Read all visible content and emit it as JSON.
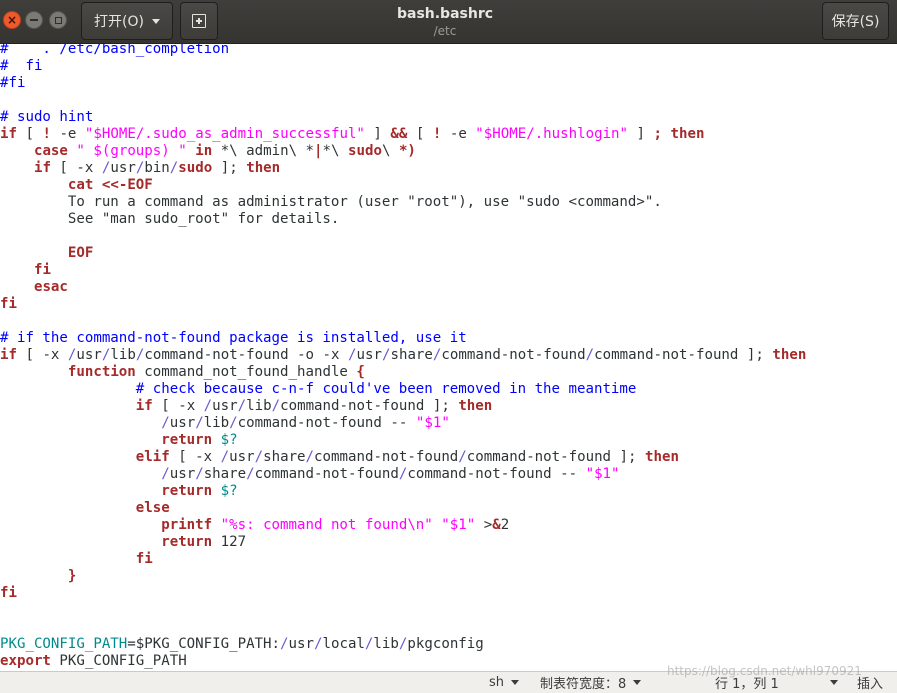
{
  "window": {
    "title": "bash.bashrc",
    "subtitle": "/etc",
    "open_label": "打开(O)",
    "save_label": "保存(S)"
  },
  "colors": {
    "comment": "#0000ff",
    "keyword": "#a52a2a",
    "string": "#ff00ff",
    "variable": "#008b8b",
    "path_separator": "#6a5acd"
  },
  "icons": {
    "close": "close-icon",
    "minimize": "minimize-icon",
    "maximize": "maximize-icon",
    "new_tab": "new-document-icon",
    "dropdown": "chevron-down-icon"
  },
  "editor": {
    "lines": [
      [
        [
          "c",
          "#    . /etc/bash_completion"
        ]
      ],
      [
        [
          "c",
          "#  fi"
        ]
      ],
      [
        [
          "c",
          "#fi"
        ]
      ],
      [
        [
          "t",
          ""
        ]
      ],
      [
        [
          "c",
          "# sudo hint"
        ]
      ],
      [
        [
          "k",
          "if"
        ],
        [
          "t",
          " [ "
        ],
        [
          "k",
          "!"
        ],
        [
          "t",
          " -e "
        ],
        [
          "s",
          "\"$HOME/.sudo_as_admin_successful\""
        ],
        [
          "t",
          " ] "
        ],
        [
          "k",
          "&&"
        ],
        [
          "t",
          " [ "
        ],
        [
          "k",
          "!"
        ],
        [
          "t",
          " -e "
        ],
        [
          "s",
          "\"$HOME/.hushlogin\""
        ],
        [
          "t",
          " ] "
        ],
        [
          "k",
          ";"
        ],
        [
          "t",
          " "
        ],
        [
          "k",
          "then"
        ]
      ],
      [
        [
          "t",
          "    "
        ],
        [
          "k",
          "case"
        ],
        [
          "t",
          " "
        ],
        [
          "s",
          "\" $(groups) \""
        ],
        [
          "t",
          " "
        ],
        [
          "k",
          "in"
        ],
        [
          "t",
          " *\\ admin\\ *"
        ],
        [
          "k",
          "|"
        ],
        [
          "t",
          "*\\ "
        ],
        [
          "k",
          "sudo"
        ],
        [
          "t",
          "\\ "
        ],
        [
          "k",
          "*)"
        ]
      ],
      [
        [
          "t",
          "    "
        ],
        [
          "k",
          "if"
        ],
        [
          "t",
          " [ -x "
        ],
        [
          "p",
          "/"
        ],
        [
          "t",
          "usr"
        ],
        [
          "p",
          "/"
        ],
        [
          "t",
          "bin"
        ],
        [
          "p",
          "/"
        ],
        [
          "k",
          "sudo"
        ],
        [
          "t",
          " ]; "
        ],
        [
          "k",
          "then"
        ]
      ],
      [
        [
          "t",
          "        "
        ],
        [
          "k",
          "cat"
        ],
        [
          "t",
          " "
        ],
        [
          "k",
          "<<-EOF"
        ]
      ],
      [
        [
          "t",
          "        To run a command as administrator (user \"root\"), use \"sudo <command>\"."
        ]
      ],
      [
        [
          "t",
          "        See \"man sudo_root\" for details."
        ]
      ],
      [
        [
          "t",
          ""
        ]
      ],
      [
        [
          "t",
          "        "
        ],
        [
          "k",
          "EOF"
        ]
      ],
      [
        [
          "t",
          "    "
        ],
        [
          "k",
          "fi"
        ]
      ],
      [
        [
          "t",
          "    "
        ],
        [
          "k",
          "esac"
        ]
      ],
      [
        [
          "k",
          "fi"
        ]
      ],
      [
        [
          "t",
          ""
        ]
      ],
      [
        [
          "c",
          "# if the command-not-found package is installed, use it"
        ]
      ],
      [
        [
          "k",
          "if"
        ],
        [
          "t",
          " [ -x "
        ],
        [
          "p",
          "/"
        ],
        [
          "t",
          "usr"
        ],
        [
          "p",
          "/"
        ],
        [
          "t",
          "lib"
        ],
        [
          "p",
          "/"
        ],
        [
          "t",
          "command-not-found -o -x "
        ],
        [
          "p",
          "/"
        ],
        [
          "t",
          "usr"
        ],
        [
          "p",
          "/"
        ],
        [
          "t",
          "share"
        ],
        [
          "p",
          "/"
        ],
        [
          "t",
          "command-not-found"
        ],
        [
          "p",
          "/"
        ],
        [
          "t",
          "command-not-found ]; "
        ],
        [
          "k",
          "then"
        ]
      ],
      [
        [
          "t",
          "        "
        ],
        [
          "k",
          "function"
        ],
        [
          "t",
          " command_not_found_handle "
        ],
        [
          "k",
          "{"
        ]
      ],
      [
        [
          "t",
          "                "
        ],
        [
          "c",
          "# check because c-n-f could've been removed in the meantime"
        ]
      ],
      [
        [
          "t",
          "                "
        ],
        [
          "k",
          "if"
        ],
        [
          "t",
          " [ -x "
        ],
        [
          "p",
          "/"
        ],
        [
          "t",
          "usr"
        ],
        [
          "p",
          "/"
        ],
        [
          "t",
          "lib"
        ],
        [
          "p",
          "/"
        ],
        [
          "t",
          "command-not-found ]; "
        ],
        [
          "k",
          "then"
        ]
      ],
      [
        [
          "t",
          "                   "
        ],
        [
          "p",
          "/"
        ],
        [
          "t",
          "usr"
        ],
        [
          "p",
          "/"
        ],
        [
          "t",
          "lib"
        ],
        [
          "p",
          "/"
        ],
        [
          "t",
          "command-not-found -- "
        ],
        [
          "s",
          "\"$1\""
        ]
      ],
      [
        [
          "t",
          "                   "
        ],
        [
          "k",
          "return"
        ],
        [
          "t",
          " "
        ],
        [
          "v",
          "$?"
        ]
      ],
      [
        [
          "t",
          "                "
        ],
        [
          "k",
          "elif"
        ],
        [
          "t",
          " [ -x "
        ],
        [
          "p",
          "/"
        ],
        [
          "t",
          "usr"
        ],
        [
          "p",
          "/"
        ],
        [
          "t",
          "share"
        ],
        [
          "p",
          "/"
        ],
        [
          "t",
          "command-not-found"
        ],
        [
          "p",
          "/"
        ],
        [
          "t",
          "command-not-found ]; "
        ],
        [
          "k",
          "then"
        ]
      ],
      [
        [
          "t",
          "                   "
        ],
        [
          "p",
          "/"
        ],
        [
          "t",
          "usr"
        ],
        [
          "p",
          "/"
        ],
        [
          "t",
          "share"
        ],
        [
          "p",
          "/"
        ],
        [
          "t",
          "command-not-found"
        ],
        [
          "p",
          "/"
        ],
        [
          "t",
          "command-not-found -- "
        ],
        [
          "s",
          "\"$1\""
        ]
      ],
      [
        [
          "t",
          "                   "
        ],
        [
          "k",
          "return"
        ],
        [
          "t",
          " "
        ],
        [
          "v",
          "$?"
        ]
      ],
      [
        [
          "t",
          "                "
        ],
        [
          "k",
          "else"
        ]
      ],
      [
        [
          "t",
          "                   "
        ],
        [
          "k",
          "printf"
        ],
        [
          "t",
          " "
        ],
        [
          "s",
          "\"%s: command not found\\n\""
        ],
        [
          "t",
          " "
        ],
        [
          "s",
          "\"$1\""
        ],
        [
          "t",
          " >"
        ],
        [
          "k",
          "&"
        ],
        [
          "t",
          "2"
        ]
      ],
      [
        [
          "t",
          "                   "
        ],
        [
          "k",
          "return"
        ],
        [
          "t",
          " 127"
        ]
      ],
      [
        [
          "t",
          "                "
        ],
        [
          "k",
          "fi"
        ]
      ],
      [
        [
          "t",
          "        "
        ],
        [
          "k",
          "}"
        ]
      ],
      [
        [
          "k",
          "fi"
        ]
      ],
      [
        [
          "t",
          ""
        ]
      ],
      [
        [
          "t",
          ""
        ]
      ],
      [
        [
          "v",
          "PKG_CONFIG_PATH"
        ],
        [
          "t",
          "=$PKG_CONFIG_PATH:"
        ],
        [
          "p",
          "/"
        ],
        [
          "t",
          "usr"
        ],
        [
          "p",
          "/"
        ],
        [
          "t",
          "local"
        ],
        [
          "p",
          "/"
        ],
        [
          "t",
          "lib"
        ],
        [
          "p",
          "/"
        ],
        [
          "t",
          "pkgconfig"
        ]
      ],
      [
        [
          "k",
          "export"
        ],
        [
          "t",
          " PKG_CONFIG_PATH"
        ]
      ]
    ]
  },
  "statusbar": {
    "language": "sh",
    "tab_width": "制表符宽度：8",
    "position": "行 1，列 1",
    "mode": "插入"
  },
  "watermark": "https://blog.csdn.net/whl970921"
}
